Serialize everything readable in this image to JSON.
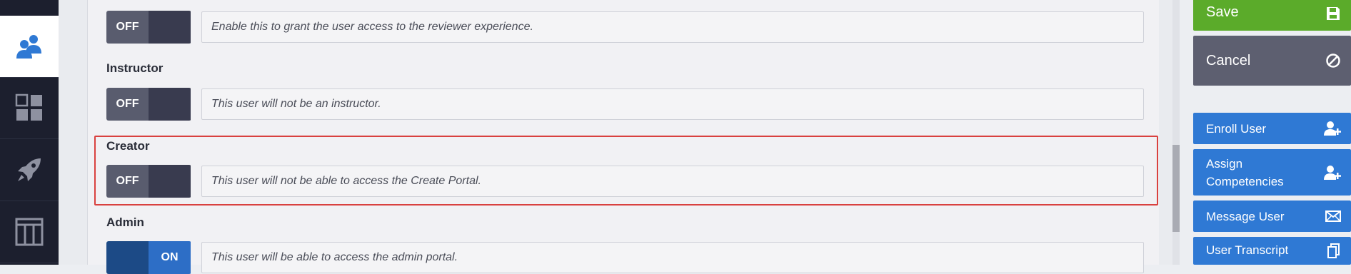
{
  "nav": {
    "items": [
      {
        "name": "users",
        "icon": "users-icon",
        "active": true
      },
      {
        "name": "dashboard",
        "icon": "dashboard-grid-icon",
        "active": false
      },
      {
        "name": "launch",
        "icon": "rocket-icon",
        "active": false
      },
      {
        "name": "layout",
        "icon": "columns-icon",
        "active": false
      }
    ]
  },
  "fields": {
    "reviewer": {
      "toggle_label": "OFF",
      "state": "off",
      "description": "Enable this to grant the user access to the reviewer experience."
    },
    "instructor": {
      "label": "Instructor",
      "toggle_label": "OFF",
      "state": "off",
      "description": "This user will not be an instructor."
    },
    "creator": {
      "label": "Creator",
      "toggle_label": "OFF",
      "state": "off",
      "description": "This user will not be able to access the Create Portal."
    },
    "admin": {
      "label": "Admin",
      "toggle_label": "ON",
      "state": "on",
      "description": "This user will be able to access the admin portal."
    }
  },
  "actions": {
    "save": {
      "label": "Save",
      "icon": "floppy-disk-icon"
    },
    "cancel": {
      "label": "Cancel",
      "icon": "ban-icon"
    },
    "enroll_user": {
      "label": "Enroll User",
      "icon": "add-user-icon"
    },
    "assign_competencies": {
      "label_line1": "Assign",
      "label_line2": "Competencies",
      "icon": "add-user-icon"
    },
    "message_user": {
      "label": "Message User",
      "icon": "envelope-icon"
    },
    "user_transcript": {
      "label": "User Transcript",
      "icon": "copy-icon"
    }
  },
  "colors": {
    "highlight": "#d9413f",
    "save": "#5bab2a",
    "cancel": "#5d5f70",
    "action_blue": "#2f79d4",
    "nav_bg": "#1c1f2e"
  }
}
